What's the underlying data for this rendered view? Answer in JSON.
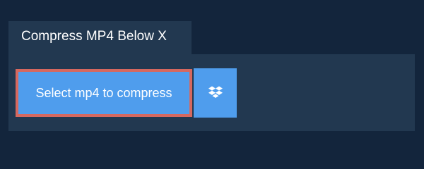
{
  "tab": {
    "title": "Compress MP4 Below X"
  },
  "panel": {
    "select_button_label": "Select mp4 to compress",
    "dropbox_icon": "dropbox-icon"
  },
  "colors": {
    "page_background": "#13253c",
    "panel_background": "#223850",
    "button_background": "#4f9ded",
    "highlight_border": "#d6685f"
  }
}
